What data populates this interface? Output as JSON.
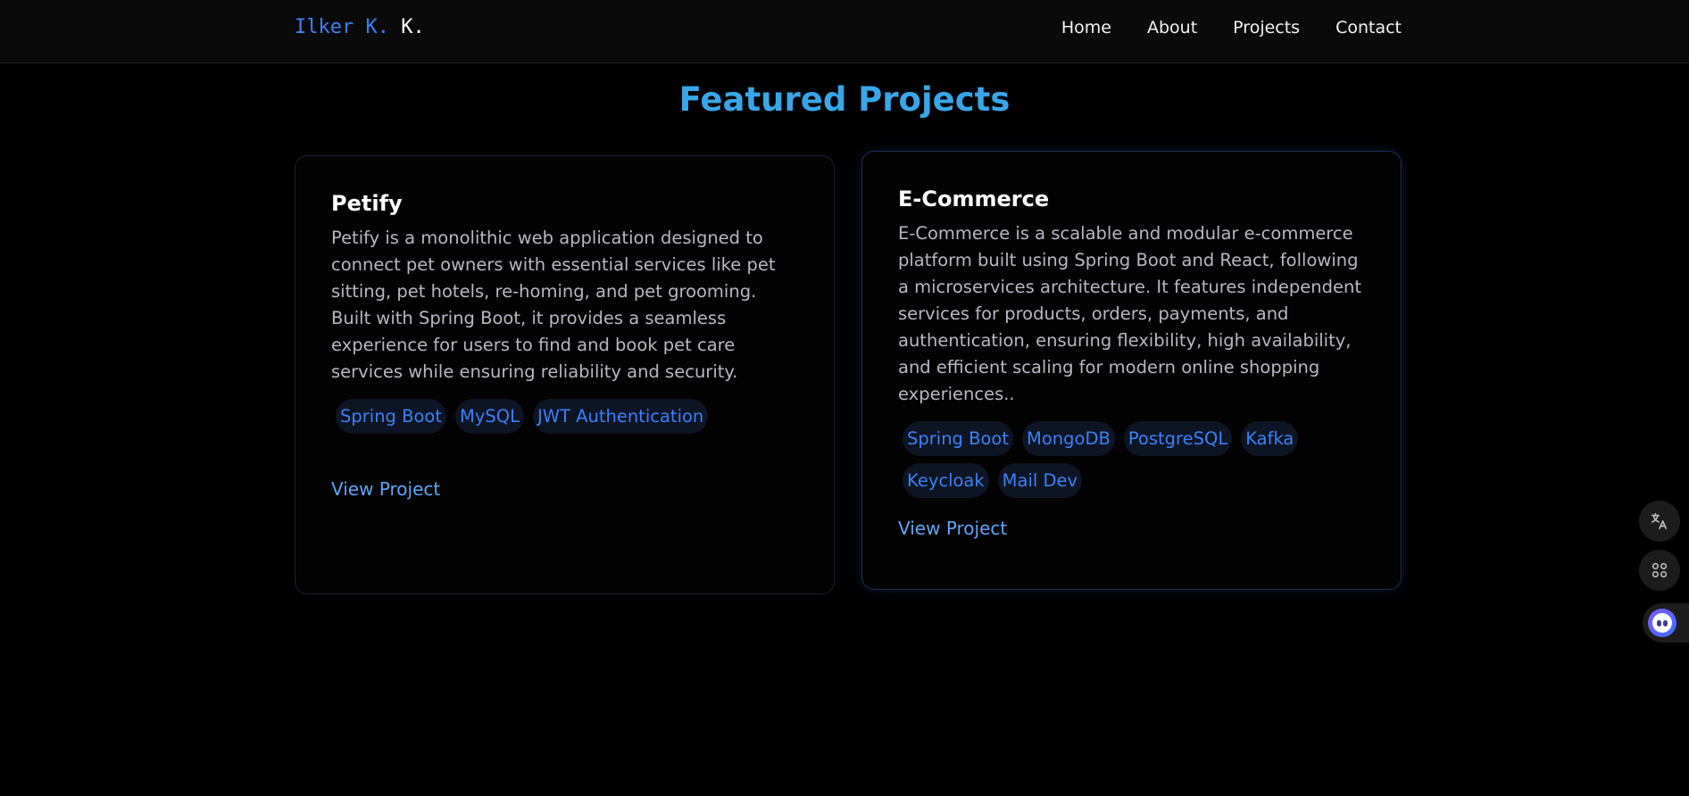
{
  "nav": {
    "logo_accent": "Ilker K.",
    "logo_rest": " K.",
    "links": [
      "Home",
      "About",
      "Projects",
      "Contact"
    ]
  },
  "section": {
    "title": "Featured Projects"
  },
  "projects": [
    {
      "title": "Petify",
      "description": "Petify is a monolithic web application designed to connect pet owners with essential services like pet sitting, pet hotels, re-homing, and pet grooming. Built with Spring Boot, it provides a seamless experience for users to find and book pet care services while ensuring reliability and security.",
      "tags": [
        "Spring Boot",
        "MySQL",
        "JWT Authentication"
      ],
      "link_label": "View Project"
    },
    {
      "title": "E-Commerce",
      "description": "E-Commerce is a scalable and modular e-commerce platform built using Spring Boot and React, following a microservices architecture. It features independent services for products, orders, payments, and authentication, ensuring flexibility, high availability, and efficient scaling for modern online shopping experiences..",
      "tags": [
        "Spring Boot",
        "MongoDB",
        "PostgreSQL",
        "Kafka",
        "Keycloak",
        "Mail Dev"
      ],
      "link_label": "View Project"
    }
  ],
  "side_tools": {
    "translate_icon": "translate-icon",
    "apps_icon": "apps-grid-icon",
    "assistant_icon": "ai-assistant-icon"
  },
  "colors": {
    "accent_blue": "#3b82f6",
    "title_blue": "#38a6e8",
    "background": "#000000"
  }
}
